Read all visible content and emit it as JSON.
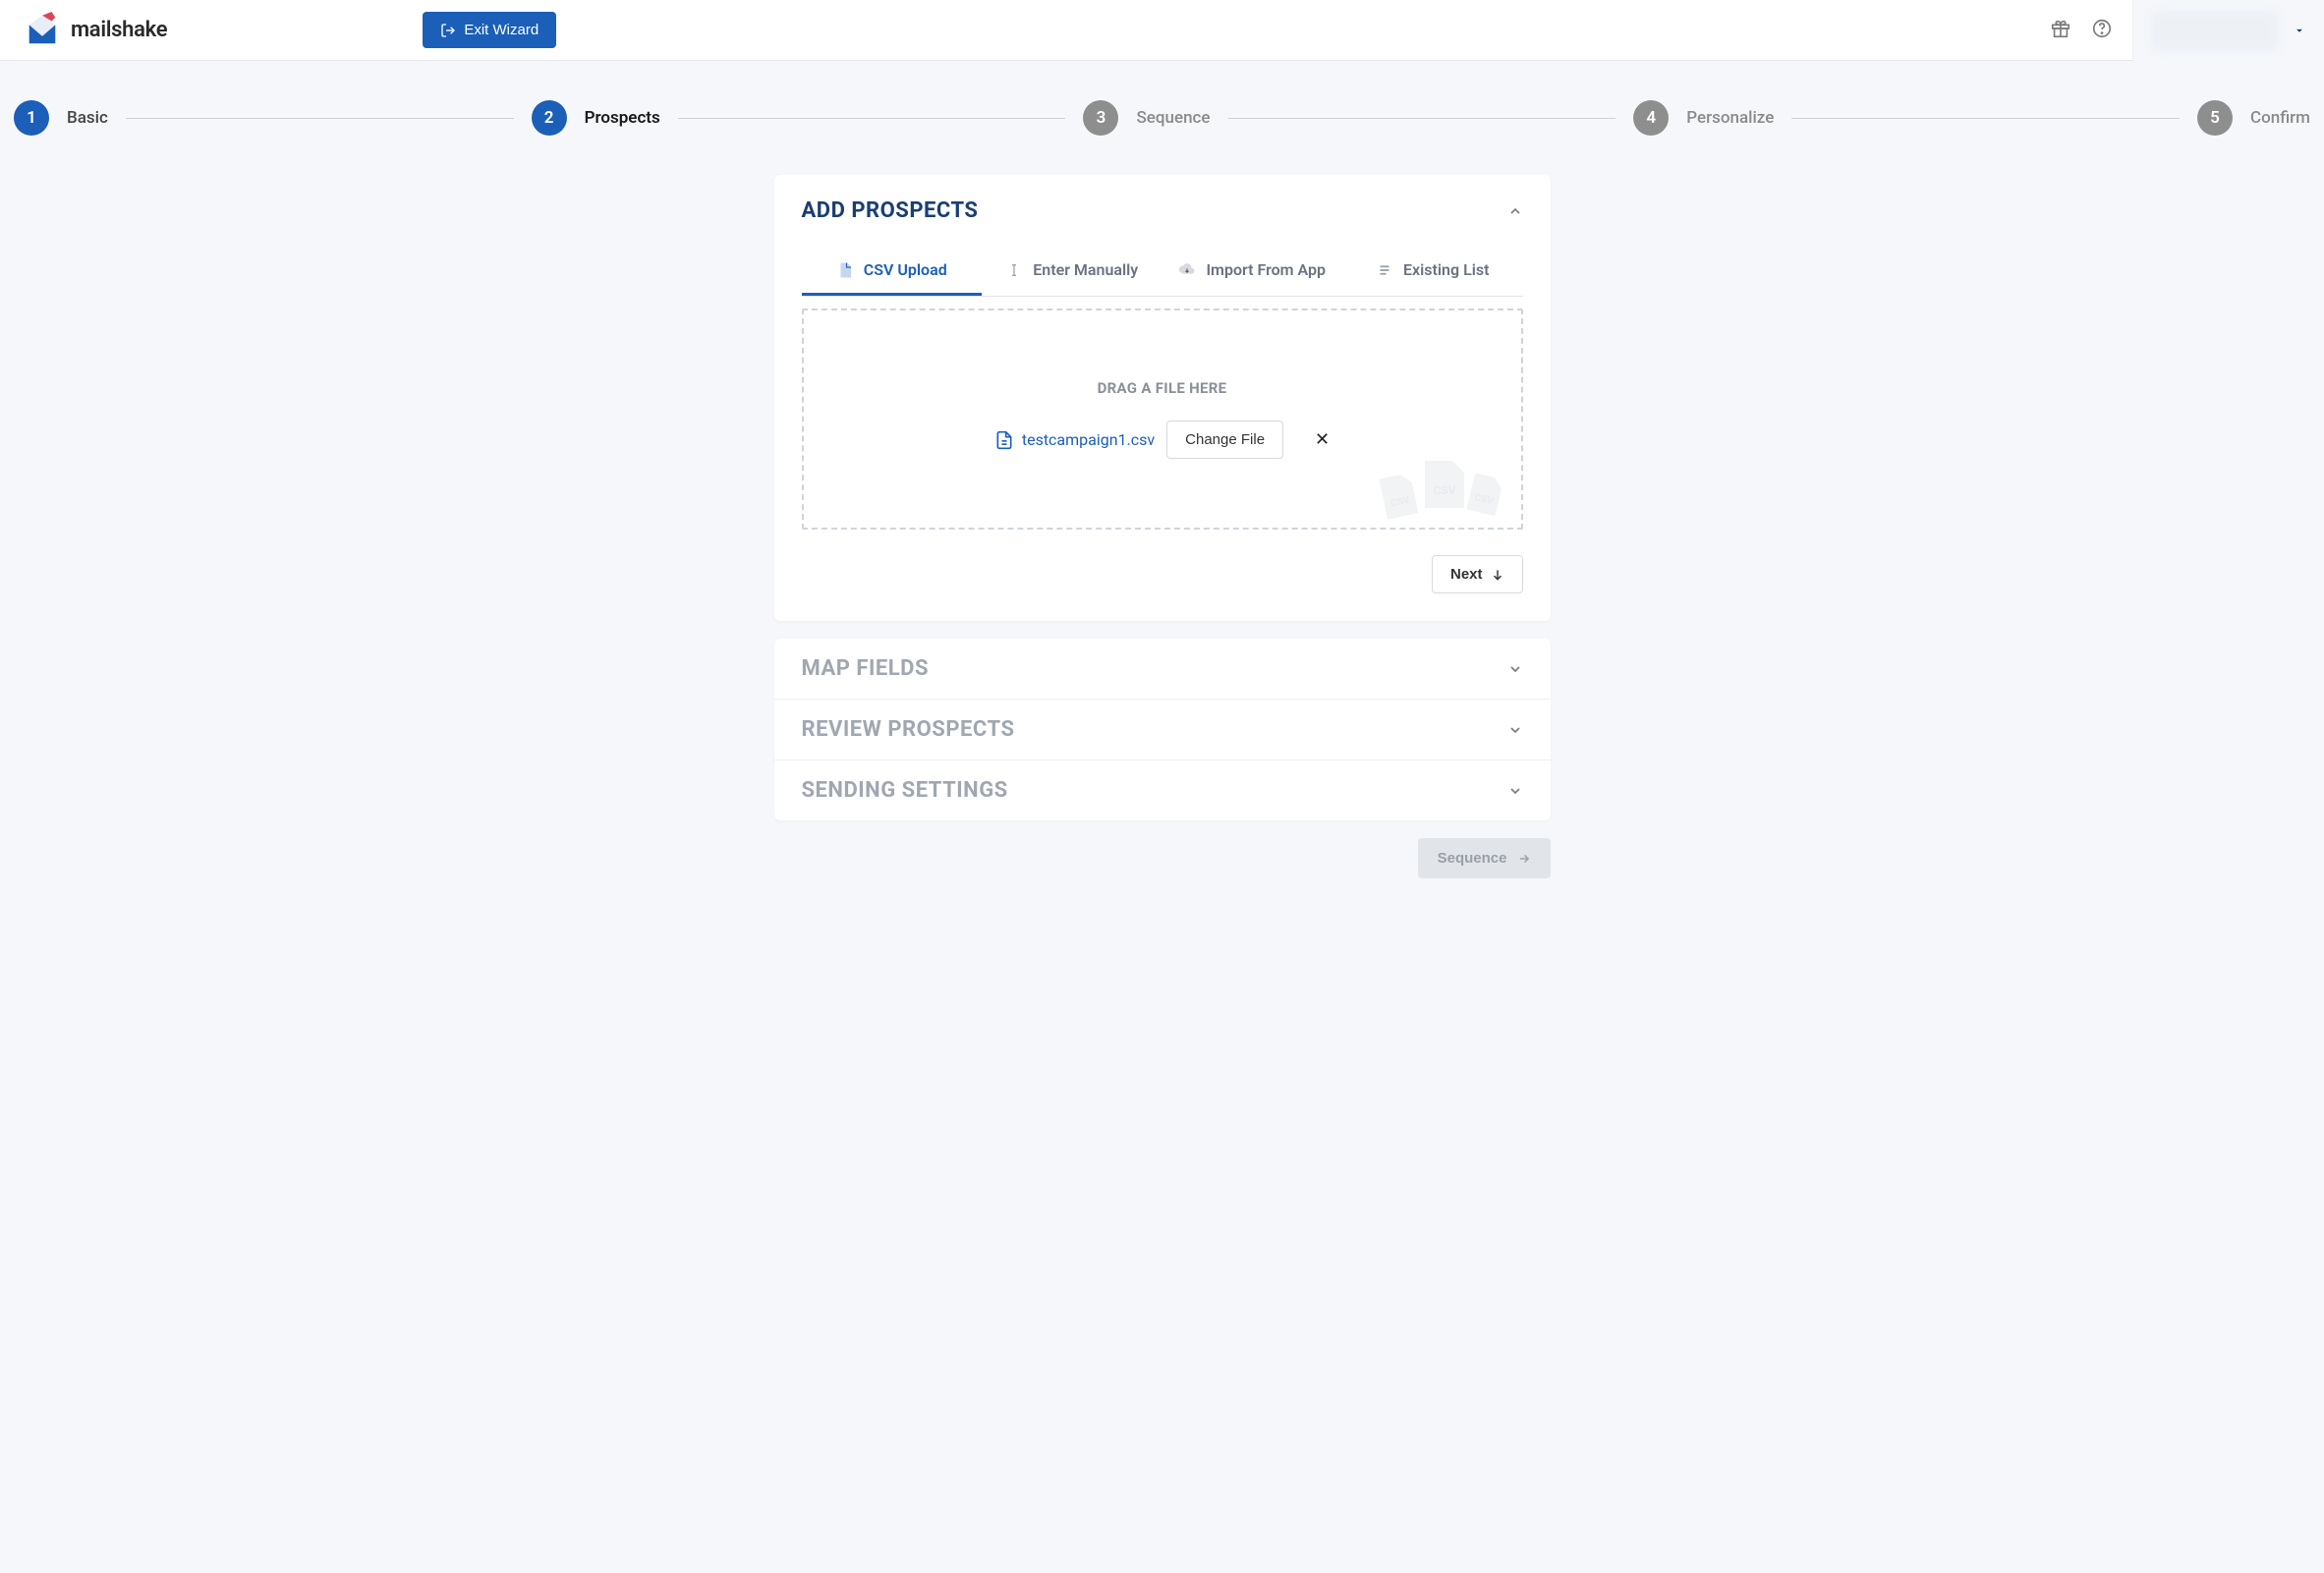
{
  "header": {
    "brand": "mailshake",
    "exit_label": "Exit Wizard"
  },
  "stepper": [
    {
      "num": "1",
      "label": "Basic",
      "state": "done"
    },
    {
      "num": "2",
      "label": "Prospects",
      "state": "active"
    },
    {
      "num": "3",
      "label": "Sequence",
      "state": "todo"
    },
    {
      "num": "4",
      "label": "Personalize",
      "state": "todo"
    },
    {
      "num": "5",
      "label": "Confirm",
      "state": "todo"
    }
  ],
  "main_panel": {
    "title": "ADD PROSPECTS",
    "tabs": {
      "csv": "CSV Upload",
      "manual": "Enter Manually",
      "import": "Import From App",
      "existing": "Existing List"
    },
    "dropzone": {
      "hint": "DRAG A FILE HERE",
      "filename": "testcampaign1.csv",
      "change_label": "Change File"
    },
    "next_label": "Next"
  },
  "collapsed_panels": {
    "map": "MAP FIELDS",
    "review": "REVIEW PROSPECTS",
    "sending": "SENDING SETTINGS"
  },
  "footer": {
    "sequence_label": "Sequence"
  }
}
